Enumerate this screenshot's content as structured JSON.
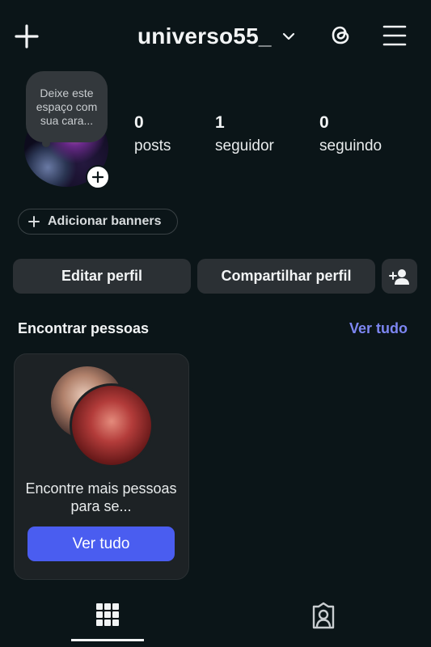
{
  "header": {
    "username": "universo55_",
    "icons": [
      "plus-icon",
      "chevron-down-icon",
      "threads-icon",
      "menu-icon"
    ]
  },
  "profile": {
    "note_text": "Deixe este espaço com sua cara...",
    "stats": [
      {
        "value": "0",
        "label": "posts"
      },
      {
        "value": "1",
        "label": "seguidor"
      },
      {
        "value": "0",
        "label": "seguindo"
      }
    ],
    "banner_button": "Adicionar banners"
  },
  "actions": {
    "edit_profile": "Editar perfil",
    "share_profile": "Compartilhar perfil"
  },
  "discover": {
    "title": "Encontrar pessoas",
    "see_all": "Ver tudo",
    "card_text": "Encontre mais pessoas para se...",
    "card_button": "Ver tudo"
  },
  "tabs": [
    "grid-icon",
    "tagged-icon"
  ],
  "colors": {
    "background": "#0b1518",
    "accent_link": "#7d86f2",
    "primary_button": "#4a5df0",
    "secondary_button": "#2b3034"
  }
}
